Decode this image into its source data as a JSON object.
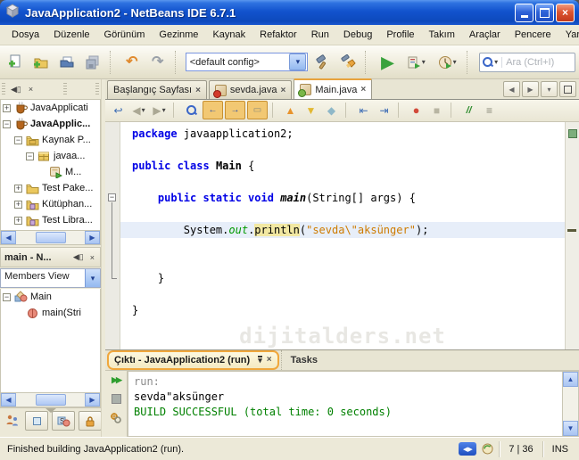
{
  "window": {
    "title": "JavaApplication2 - NetBeans IDE 6.7.1"
  },
  "glyphs": {
    "close": "×",
    "caret": "▾",
    "left": "◀",
    "right": "▶",
    "up": "▲",
    "down": "▼",
    "undo": "↶",
    "redo": "↷",
    "back": "↩",
    "larr": "←",
    "rarr": "→",
    "shiftl": "⇤",
    "shiftr": "⇥",
    "dot": "●",
    "square": "■",
    "lines": "≡",
    "diamond": "◆",
    "slashes": "//",
    "run": "▶",
    "rerun": "▶▶",
    "minus": "−",
    "lr": "◀▶",
    "bar": "▭"
  },
  "menubar": {
    "items": [
      {
        "label": "Dosya"
      },
      {
        "label": "Düzenle"
      },
      {
        "label": "Görünüm"
      },
      {
        "label": "Gezinme"
      },
      {
        "label": "Kaynak"
      },
      {
        "label": "Refaktor"
      },
      {
        "label": "Run"
      },
      {
        "label": "Debug"
      },
      {
        "label": "Profile"
      },
      {
        "label": "Takım"
      },
      {
        "label": "Araçlar"
      },
      {
        "label": "Pencere"
      },
      {
        "label": "Yardım"
      }
    ]
  },
  "toolbar": {
    "config_select": "<default config>",
    "search_placeholder": "Ara (Ctrl+I)",
    "icons": [
      "new-file-icon",
      "new-project-icon",
      "open-project-icon",
      "save-all-icon",
      "undo-icon",
      "redo-icon",
      "build-icon",
      "clean-build-icon",
      "run-icon",
      "debug-icon",
      "profile-icon",
      "search-icon"
    ]
  },
  "left": {
    "projects": {
      "items": [
        {
          "label": "JavaApplicati",
          "level": 0,
          "expander": "+",
          "icon": "java-project-icon",
          "bold": false
        },
        {
          "label": "JavaApplic...",
          "level": 0,
          "expander": "-",
          "icon": "java-project-icon",
          "bold": true
        },
        {
          "label": "Kaynak P...",
          "level": 1,
          "expander": "-",
          "icon": "source-folder-icon",
          "bold": false
        },
        {
          "label": "javaa...",
          "level": 2,
          "expander": "-",
          "icon": "package-icon",
          "bold": false
        },
        {
          "label": "M...",
          "level": 3,
          "expander": "",
          "icon": "main-class-icon",
          "bold": false
        },
        {
          "label": "Test Pake...",
          "level": 1,
          "expander": "+",
          "icon": "folder-icon",
          "bold": false
        },
        {
          "label": "Kütüphan...",
          "level": 1,
          "expander": "+",
          "icon": "libraries-icon",
          "bold": false
        },
        {
          "label": "Test Libra...",
          "level": 1,
          "expander": "+",
          "icon": "libraries-icon",
          "bold": false
        }
      ]
    },
    "navigator": {
      "title": "main - N...",
      "view_select": "Members View",
      "items": [
        {
          "label": "Main",
          "level": 0,
          "expander": "-",
          "icon": "class-icon"
        },
        {
          "label": "main(Stri",
          "level": 1,
          "expander": "",
          "icon": "method-icon"
        }
      ],
      "filter_icons": [
        "inherited-members-icon",
        "show-fields-icon",
        "show-static-members-icon",
        "show-non-public-icon"
      ]
    }
  },
  "editor": {
    "tabs": [
      {
        "label": "Başlangıç Sayfası",
        "active": false,
        "icon": ""
      },
      {
        "label": "sevda.java",
        "active": false,
        "icon": "java-file-error-icon"
      },
      {
        "label": "Main.java",
        "active": true,
        "icon": "java-file-run-icon"
      }
    ],
    "toolbar_icons": [
      "last-edit-position-icon",
      "back-icon",
      "forward-icon",
      "find-selection-icon",
      "previous-occurrence-icon",
      "next-occurrence-icon",
      "toggle-highlight-icon",
      "previous-bookmark-icon",
      "next-bookmark-icon",
      "toggle-bookmark-icon",
      "shift-left-icon",
      "shift-right-icon",
      "record-macro-icon",
      "stop-macro-icon",
      "comment-icon",
      "uncomment-icon"
    ],
    "code": {
      "lines": [
        {
          "tokens": [
            {
              "c": "kw",
              "t": "package"
            },
            {
              "c": "pl",
              "t": " javaapplication2;"
            }
          ]
        },
        {
          "tokens": []
        },
        {
          "tokens": [
            {
              "c": "kw",
              "t": "public class"
            },
            {
              "c": "pl",
              "t": " "
            },
            {
              "c": "cls",
              "t": "Main"
            },
            {
              "c": "pl",
              "t": " {"
            }
          ]
        },
        {
          "tokens": []
        },
        {
          "tokens": [
            {
              "c": "pl",
              "t": "    "
            },
            {
              "c": "kw",
              "t": "public static void"
            },
            {
              "c": "pl",
              "t": " "
            },
            {
              "c": "mth",
              "t": "main"
            },
            {
              "c": "pl",
              "t": "(String[] args) {"
            }
          ]
        },
        {
          "tokens": []
        },
        {
          "current": true,
          "tokens": [
            {
              "c": "pl",
              "t": "        System."
            },
            {
              "c": "fld",
              "t": "out"
            },
            {
              "c": "pl",
              "t": "."
            },
            {
              "c": "occ",
              "t": "println"
            },
            {
              "c": "pl",
              "t": "("
            },
            {
              "c": "str",
              "t": "\"sevda\\\"aksünger\""
            },
            {
              "c": "pl",
              "t": ");"
            }
          ]
        },
        {
          "tokens": []
        },
        {
          "tokens": []
        },
        {
          "tokens": [
            {
              "c": "pl",
              "t": "    }"
            }
          ]
        },
        {
          "tokens": []
        },
        {
          "tokens": [
            {
              "c": "pl",
              "t": "}"
            }
          ]
        }
      ]
    },
    "watermark": "dijitalders.net"
  },
  "output": {
    "tab": "Çıktı - JavaApplication2 (run)",
    "tasks_tab": "Tasks",
    "side_icons": [
      "rerun-icon",
      "stop-icon",
      "ant-settings-icon"
    ],
    "lines": [
      {
        "c": "dim",
        "t": "run:"
      },
      {
        "c": "pl",
        "t": "sevda\"aksünger"
      },
      {
        "c": "ok",
        "t": "BUILD SUCCESSFUL (total time: 0 seconds)"
      }
    ]
  },
  "statusbar": {
    "message": "Finished building JavaApplication2 (run).",
    "icons": [
      "editor-sync-icon",
      "refresh-icon"
    ],
    "position": "7 | 36",
    "mode": "INS"
  },
  "colors": {
    "titlebar_blue": "#1253CE",
    "window_border": "#0A44C8",
    "xp_beige": "#ECE9D8",
    "tab_accent_orange": "#E8A33D",
    "keyword_blue": "#0000E6",
    "string_orange": "#CE7B00",
    "field_green": "#009900",
    "build_success_green": "#008000",
    "current_line_blue": "#E7EEF9",
    "occurrence_yellow": "#F2E8A2"
  }
}
